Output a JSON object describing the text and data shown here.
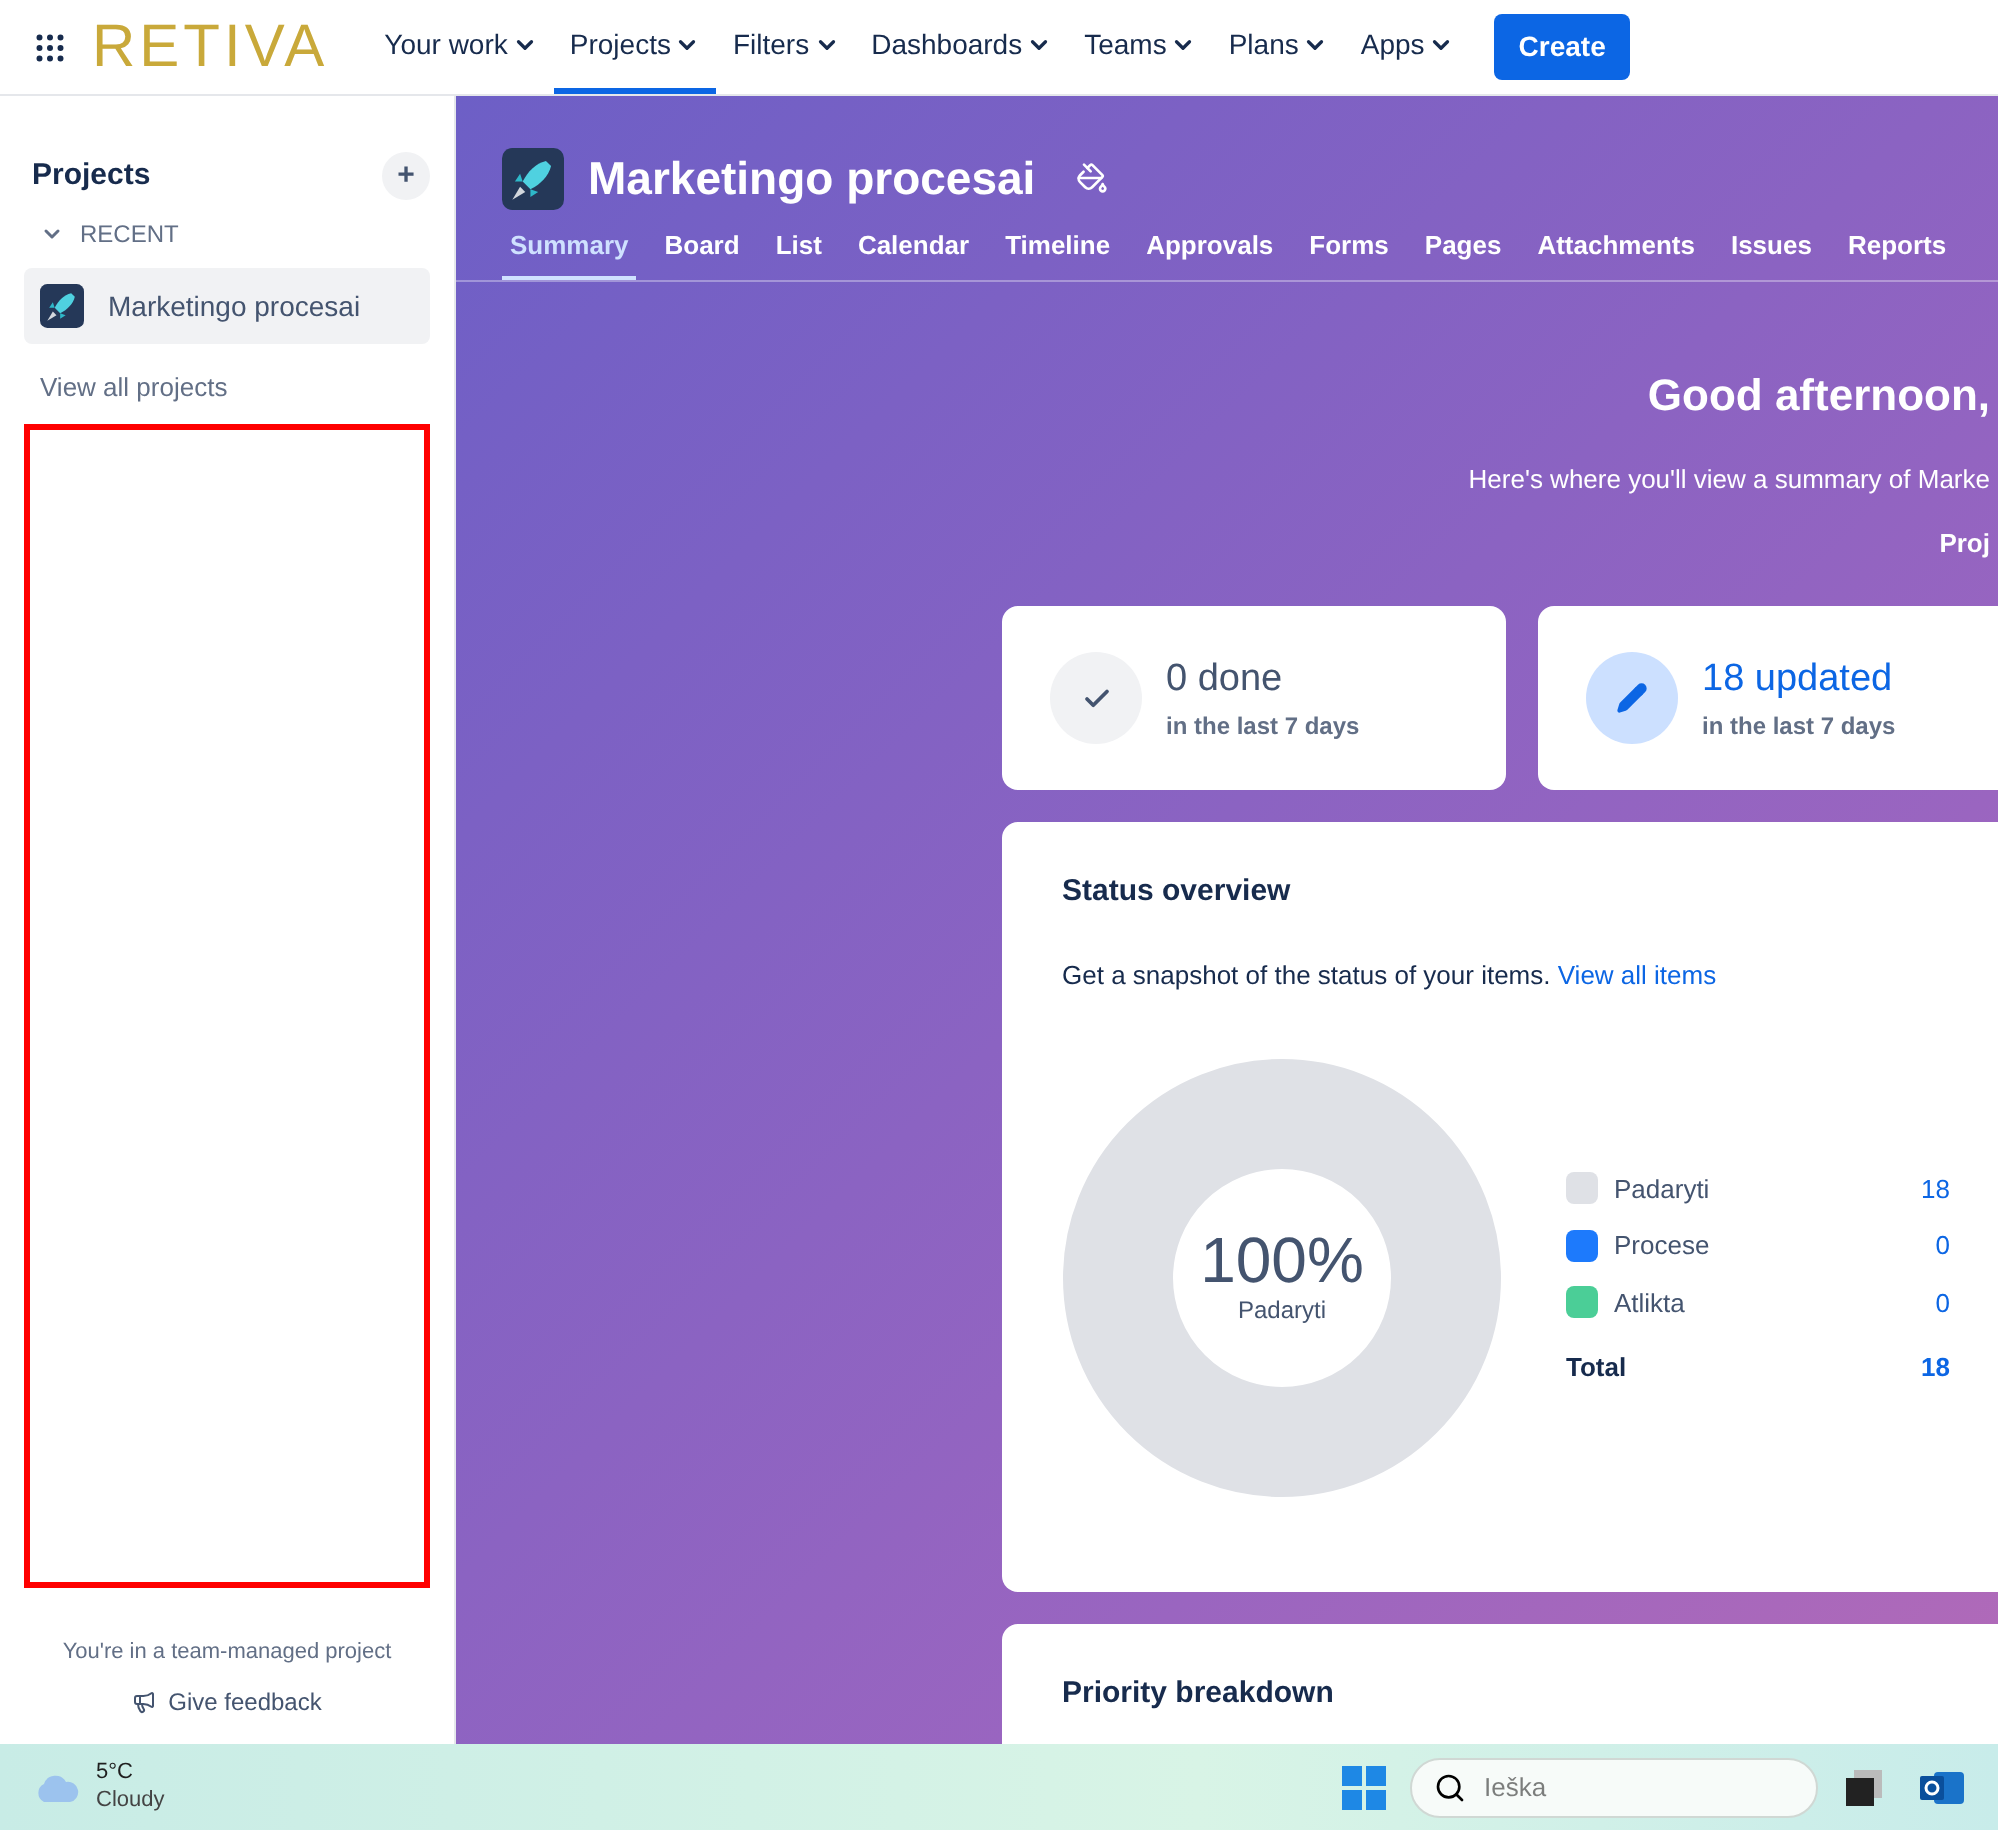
{
  "top_nav": {
    "logo": "RETIVA",
    "items": [
      {
        "label": "Your work",
        "selected": false
      },
      {
        "label": "Projects",
        "selected": true
      },
      {
        "label": "Filters",
        "selected": false
      },
      {
        "label": "Dashboards",
        "selected": false
      },
      {
        "label": "Teams",
        "selected": false
      },
      {
        "label": "Plans",
        "selected": false
      },
      {
        "label": "Apps",
        "selected": false
      }
    ],
    "create_button": "Create"
  },
  "sidebar": {
    "title": "Projects",
    "add_button": "+",
    "section": "RECENT",
    "projects": [
      {
        "name": "Marketingo procesai",
        "selected": true
      }
    ],
    "view_all": "View all projects",
    "footer_note": "You're in a team-managed project",
    "feedback": "Give feedback"
  },
  "project": {
    "title": "Marketingo procesai",
    "tabs": [
      {
        "label": "Summary",
        "selected": true
      },
      {
        "label": "Board",
        "selected": false
      },
      {
        "label": "List",
        "selected": false
      },
      {
        "label": "Calendar",
        "selected": false
      },
      {
        "label": "Timeline",
        "selected": false
      },
      {
        "label": "Approvals",
        "selected": false
      },
      {
        "label": "Forms",
        "selected": false
      },
      {
        "label": "Pages",
        "selected": false
      },
      {
        "label": "Attachments",
        "selected": false
      },
      {
        "label": "Issues",
        "selected": false
      },
      {
        "label": "Reports",
        "selected": false
      }
    ]
  },
  "hero": {
    "greeting": "Good afternoon,",
    "subtitle": "Here's where you'll view a summary of Marke",
    "line_3": "Proj"
  },
  "stats": [
    {
      "kind": "done",
      "value": "0 done",
      "caption": "in the last 7 days"
    },
    {
      "kind": "updated",
      "value": "18 updated",
      "caption": "in the last 7 days"
    }
  ],
  "status_overview": {
    "title": "Status overview",
    "description": "Get a snapshot of the status of your items.",
    "link": "View all items",
    "center_value": "100%",
    "center_label": "Padaryti",
    "legend": [
      {
        "label": "Padaryti",
        "count": "18",
        "color": "#dfe1e6"
      },
      {
        "label": "Procese",
        "count": "0",
        "color": "#1d7afc"
      },
      {
        "label": "Atlikta",
        "count": "0",
        "color": "#4bce97"
      }
    ],
    "total_label": "Total",
    "total_count": "18"
  },
  "priority": {
    "title": "Priority breakdown"
  },
  "taskbar": {
    "temperature": "5°C",
    "weather": "Cloudy",
    "search_placeholder": "Ieška"
  }
}
